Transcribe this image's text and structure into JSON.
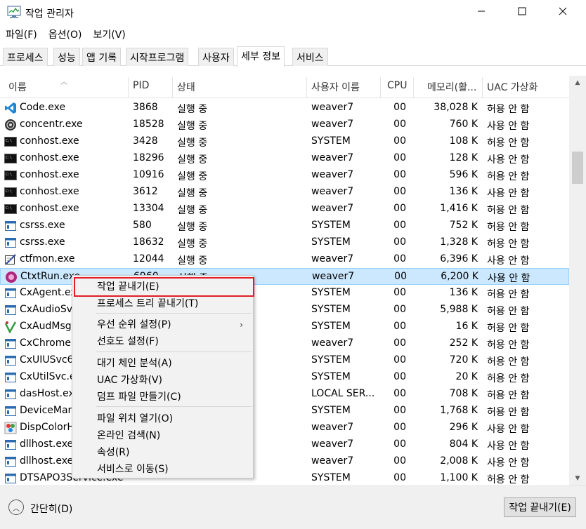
{
  "window": {
    "title": "작업 관리자",
    "min_icon": "minimize-icon",
    "max_icon": "maximize-icon",
    "close_icon": "close-icon"
  },
  "menubar": [
    "파일(F)",
    "옵션(O)",
    "보기(V)"
  ],
  "tabs": [
    "프로세스",
    "성능",
    "앱 기록",
    "시작프로그램",
    "사용자",
    "세부 정보",
    "서비스"
  ],
  "active_tab": "세부 정보",
  "columns": {
    "name": "이름",
    "pid": "PID",
    "status": "상태",
    "user": "사용자 이름",
    "cpu": "CPU",
    "memory": "메모리(활...",
    "uac": "UAC 가상화"
  },
  "rows": [
    {
      "name": "Code.exe",
      "pid": "3868",
      "status": "실행 중",
      "user": "weaver7",
      "cpu": "00",
      "mem": "38,028 K",
      "uac": "허용 안 함",
      "icon": "vscode-icon"
    },
    {
      "name": "concentr.exe",
      "pid": "18528",
      "status": "실행 중",
      "user": "weaver7",
      "cpu": "00",
      "mem": "760 K",
      "uac": "사용 안 함",
      "icon": "concentr-icon"
    },
    {
      "name": "conhost.exe",
      "pid": "3428",
      "status": "실행 중",
      "user": "SYSTEM",
      "cpu": "00",
      "mem": "108 K",
      "uac": "허용 안 함",
      "icon": "console-icon"
    },
    {
      "name": "conhost.exe",
      "pid": "18296",
      "status": "실행 중",
      "user": "weaver7",
      "cpu": "00",
      "mem": "128 K",
      "uac": "사용 안 함",
      "icon": "console-icon"
    },
    {
      "name": "conhost.exe",
      "pid": "10916",
      "status": "실행 중",
      "user": "weaver7",
      "cpu": "00",
      "mem": "596 K",
      "uac": "허용 안 함",
      "icon": "console-icon"
    },
    {
      "name": "conhost.exe",
      "pid": "3612",
      "status": "실행 중",
      "user": "weaver7",
      "cpu": "00",
      "mem": "136 K",
      "uac": "사용 안 함",
      "icon": "console-icon"
    },
    {
      "name": "conhost.exe",
      "pid": "13304",
      "status": "실행 중",
      "user": "weaver7",
      "cpu": "00",
      "mem": "1,416 K",
      "uac": "허용 안 함",
      "icon": "console-icon"
    },
    {
      "name": "csrss.exe",
      "pid": "580",
      "status": "실행 중",
      "user": "SYSTEM",
      "cpu": "00",
      "mem": "752 K",
      "uac": "허용 안 함",
      "icon": "window-icon"
    },
    {
      "name": "csrss.exe",
      "pid": "18632",
      "status": "실행 중",
      "user": "SYSTEM",
      "cpu": "00",
      "mem": "1,328 K",
      "uac": "허용 안 함",
      "icon": "window-icon"
    },
    {
      "name": "ctfmon.exe",
      "pid": "12044",
      "status": "실행 중",
      "user": "weaver7",
      "cpu": "00",
      "mem": "6,396 K",
      "uac": "사용 안 함",
      "icon": "ctfmon-icon"
    },
    {
      "name": "CtxtRun.exe",
      "pid": "6960",
      "status": "실행 중",
      "user": "weaver7",
      "cpu": "00",
      "mem": "6,200 K",
      "uac": "사용 안 함",
      "icon": "ctxtrun-icon",
      "selected": true
    },
    {
      "name": "CxAgent.exe",
      "pid": "",
      "status": "",
      "user": "SYSTEM",
      "cpu": "00",
      "mem": "136 K",
      "uac": "허용 안 함",
      "icon": "window-icon"
    },
    {
      "name": "CxAudioSvc.exe",
      "pid": "",
      "status": "",
      "user": "SYSTEM",
      "cpu": "00",
      "mem": "5,988 K",
      "uac": "허용 안 함",
      "icon": "window-icon"
    },
    {
      "name": "CxAudMsg64.exe",
      "pid": "",
      "status": "",
      "user": "SYSTEM",
      "cpu": "00",
      "mem": "16 K",
      "uac": "허용 안 함",
      "icon": "cxaudmsg-icon"
    },
    {
      "name": "CxChrome.exe",
      "pid": "",
      "status": "",
      "user": "weaver7",
      "cpu": "00",
      "mem": "252 K",
      "uac": "허용 안 함",
      "icon": "window-icon"
    },
    {
      "name": "CxUIUSvc64.exe",
      "pid": "",
      "status": "",
      "user": "SYSTEM",
      "cpu": "00",
      "mem": "720 K",
      "uac": "허용 안 함",
      "icon": "window-icon"
    },
    {
      "name": "CxUtilSvc.exe",
      "pid": "",
      "status": "",
      "user": "SYSTEM",
      "cpu": "00",
      "mem": "20 K",
      "uac": "허용 안 함",
      "icon": "window-icon"
    },
    {
      "name": "dasHost.exe",
      "pid": "",
      "status": "",
      "user": "LOCAL SER...",
      "cpu": "00",
      "mem": "708 K",
      "uac": "허용 안 함",
      "icon": "window-icon"
    },
    {
      "name": "DeviceManager.exe",
      "pid": "",
      "status": "",
      "user": "SYSTEM",
      "cpu": "00",
      "mem": "1,768 K",
      "uac": "허용 안 함",
      "icon": "window-icon"
    },
    {
      "name": "DispColorHelper.exe",
      "pid": "",
      "status": "",
      "user": "weaver7",
      "cpu": "00",
      "mem": "296 K",
      "uac": "사용 안 함",
      "icon": "dispcolor-icon"
    },
    {
      "name": "dllhost.exe",
      "pid": "",
      "status": "",
      "user": "weaver7",
      "cpu": "00",
      "mem": "804 K",
      "uac": "사용 안 함",
      "icon": "window-icon"
    },
    {
      "name": "dllhost.exe",
      "pid": "",
      "status": "",
      "user": "weaver7",
      "cpu": "00",
      "mem": "2,008 K",
      "uac": "사용 안 함",
      "icon": "window-icon"
    },
    {
      "name": "DTSAPO3Service.exe",
      "pid": "",
      "status": "",
      "user": "SYSTEM",
      "cpu": "00",
      "mem": "1,100 K",
      "uac": "허용 안 함",
      "icon": "window-icon"
    }
  ],
  "context_menu": {
    "items": [
      {
        "label": "작업 끝내기(E)",
        "highlighted": true
      },
      {
        "label": "프로세스 트리 끝내기(T)"
      },
      {
        "label": "우선 순위 설정(P)",
        "submenu": true
      },
      {
        "label": "선호도 설정(F)"
      },
      {
        "label": "대기 체인 분석(A)"
      },
      {
        "label": "UAC 가상화(V)"
      },
      {
        "label": "덤프 파일 만들기(C)"
      },
      {
        "label": "파일 위치 열기(O)"
      },
      {
        "label": "온라인 검색(N)"
      },
      {
        "label": "속성(R)"
      },
      {
        "label": "서비스로 이동(S)"
      }
    ]
  },
  "footer": {
    "collapse_label": "간단히(D)",
    "end_task_label": "작업 끝내기(E)"
  },
  "colors": {
    "selected_row": "#cce8ff",
    "highlight_box": "#e11d2b"
  }
}
